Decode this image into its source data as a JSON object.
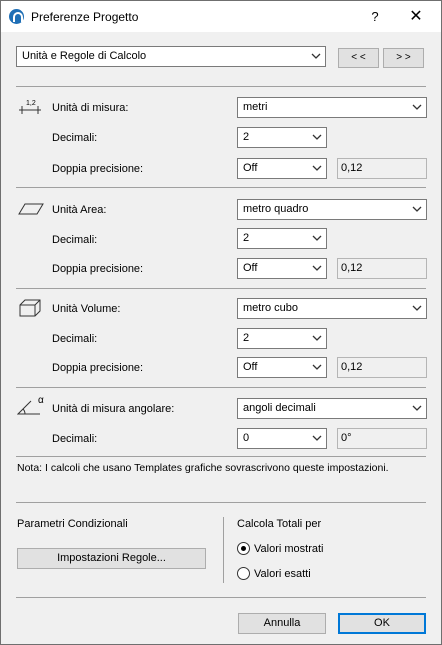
{
  "window": {
    "title": "Preferenze Progetto",
    "help_label": "?",
    "close_label": "✕"
  },
  "page_selector": {
    "value": "Unità e Regole di Calcolo"
  },
  "nav": {
    "prev_label": "< <",
    "next_label": "> >"
  },
  "length": {
    "label": "Unità di misura:",
    "icon_text": "1,2",
    "unit": "metri",
    "decimals_label": "Decimali:",
    "decimals": "2",
    "double_label": "Doppia precisione:",
    "double": "Off",
    "preview": "0,12"
  },
  "area": {
    "label": "Unità Area:",
    "unit": "metro quadro",
    "decimals_label": "Decimali:",
    "decimals": "2",
    "double_label": "Doppia precisione:",
    "double": "Off",
    "preview": "0,12"
  },
  "volume": {
    "label": "Unità Volume:",
    "unit": "metro cubo",
    "decimals_label": "Decimali:",
    "decimals": "2",
    "double_label": "Doppia precisione:",
    "double": "Off",
    "preview": "0,12"
  },
  "angle": {
    "label": "Unità di misura angolare:",
    "icon_text": "α",
    "unit": "angoli decimali",
    "decimals_label": "Decimali:",
    "decimals": "0",
    "preview": "0°"
  },
  "note": "Nota: I calcoli che usano Templates grafiche sovrascrivono queste impostazioni.",
  "conditional": {
    "title": "Parametri Condizionali",
    "button_label": "Impostazioni Regole..."
  },
  "totals": {
    "title": "Calcola Totali per",
    "options": [
      {
        "label": "Valori mostrati",
        "checked": true
      },
      {
        "label": "Valori esatti",
        "checked": false
      }
    ]
  },
  "footer": {
    "cancel_label": "Annulla",
    "ok_label": "OK"
  }
}
